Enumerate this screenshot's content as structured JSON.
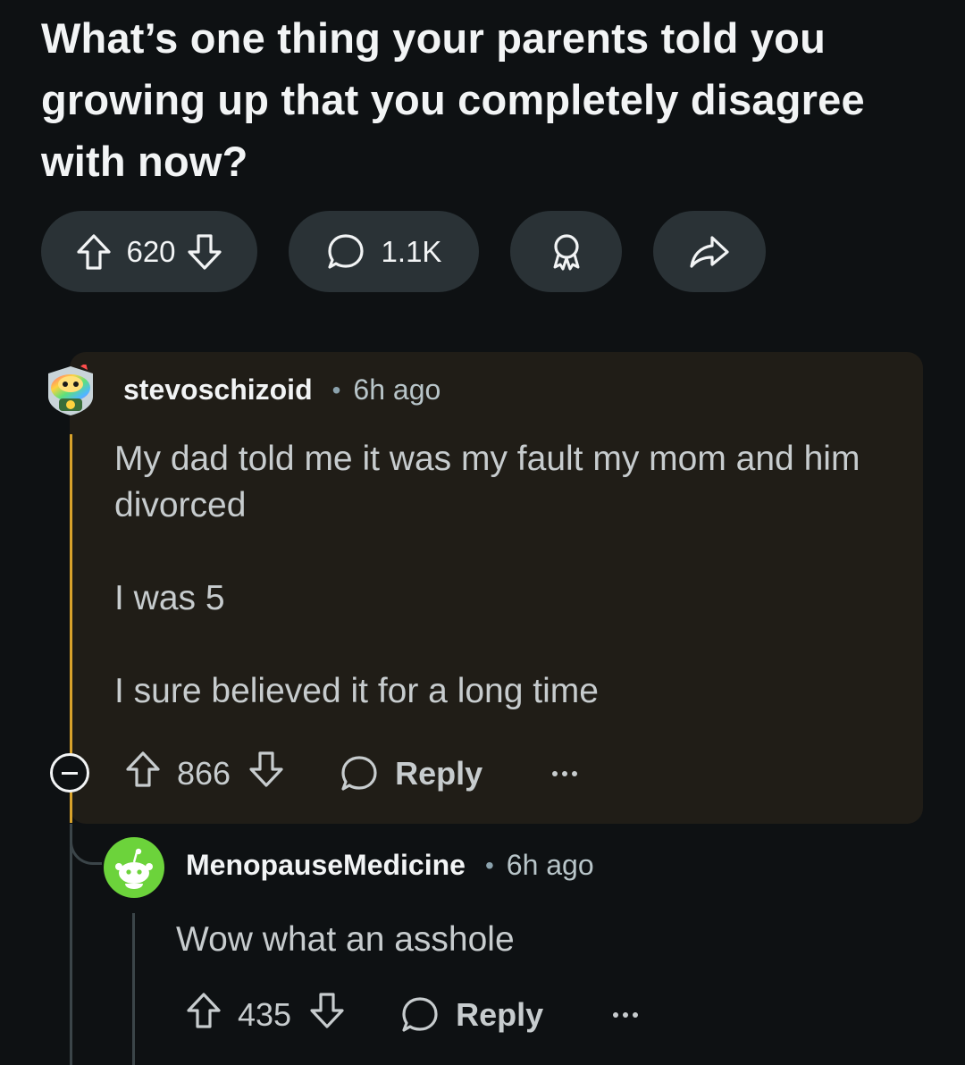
{
  "post": {
    "title": "What’s one thing your parents told you growing up that you completely disagree with now?",
    "score": "620",
    "comment_count": "1.1K"
  },
  "comments": [
    {
      "author": "stevoschizoid",
      "separator": "•",
      "time": "6h ago",
      "paragraphs": [
        "My dad told me it was my fault my mom and him divorced",
        "I was 5",
        "I sure believed it for a long time"
      ],
      "score": "866",
      "reply_label": "Reply"
    },
    {
      "author": "MenopauseMedicine",
      "separator": "•",
      "time": "6h ago",
      "paragraphs": [
        "Wow what an asshole"
      ],
      "score": "435",
      "reply_label": "Reply"
    }
  ],
  "colors": {
    "background": "#0e1113",
    "pill": "#2a3236",
    "highlight_card": "#201d17",
    "thread_gold": "#d8a22b",
    "thread_grey": "#3b4549",
    "avatar_green": "#6cd33b"
  },
  "icons": {
    "upvote": "arrow-up-outline-icon",
    "downvote": "arrow-down-outline-icon",
    "comment": "speech-bubble-icon",
    "award": "award-ribbon-icon",
    "share": "share-arrow-icon",
    "collapse": "minus-circle-icon",
    "more": "ellipsis-icon"
  }
}
